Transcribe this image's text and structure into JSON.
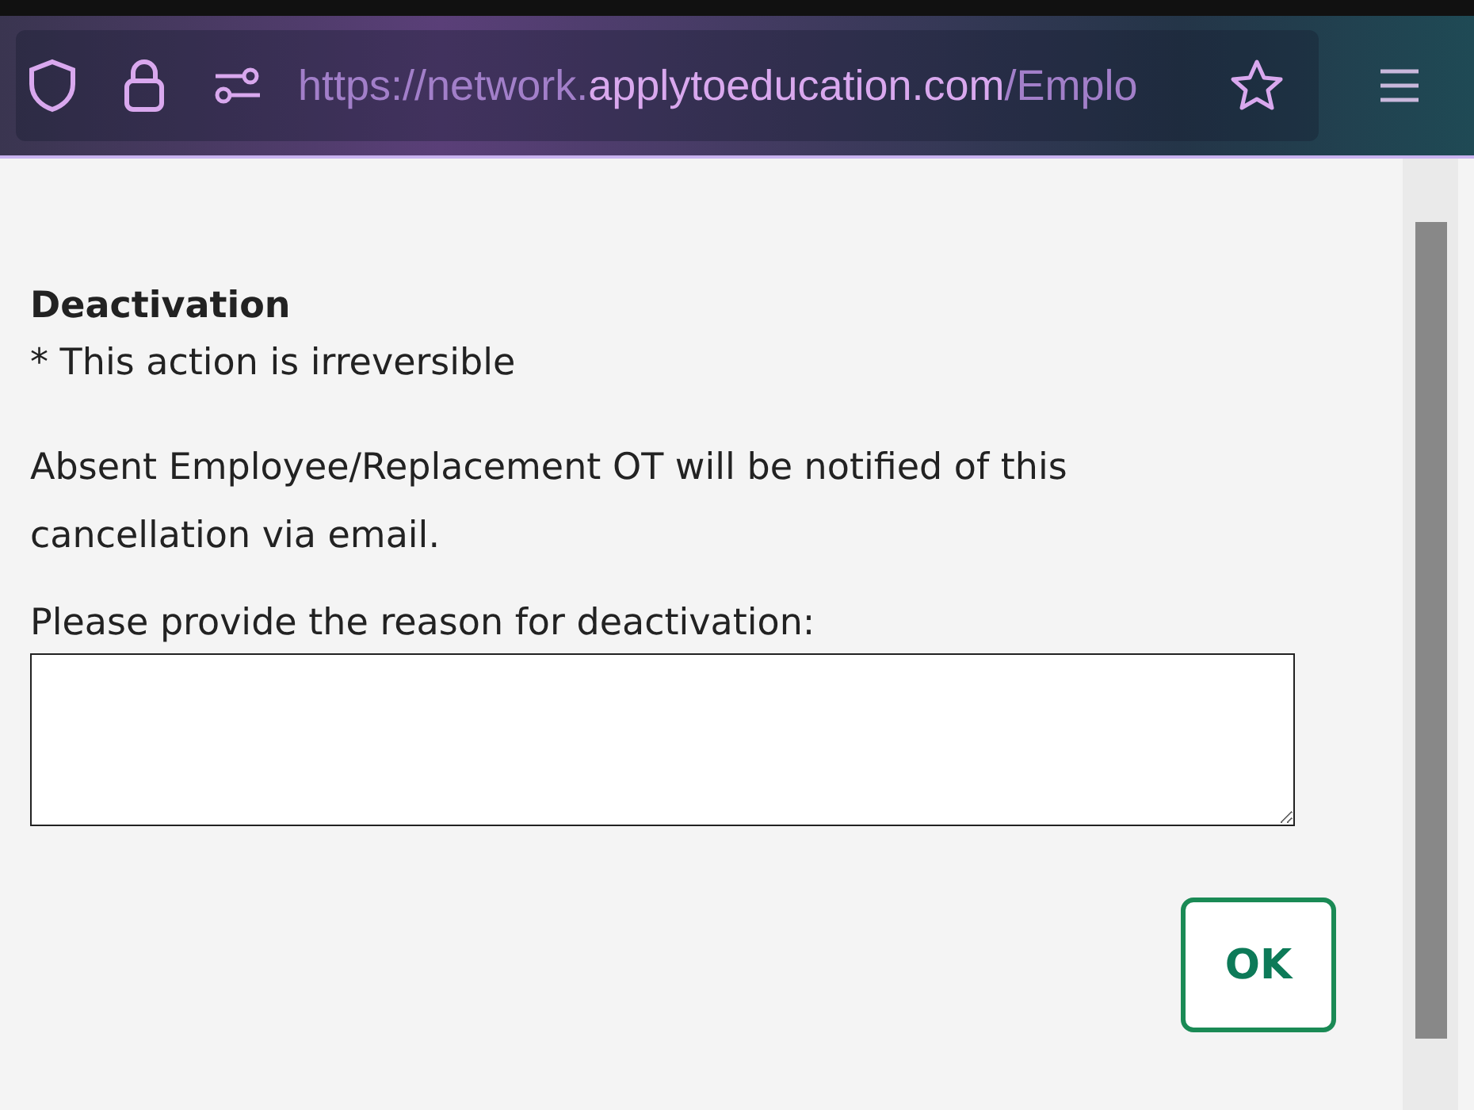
{
  "browser": {
    "url_scheme": "https://network.",
    "url_host": "applytoeducation.com",
    "url_path": "/Emplo"
  },
  "dialog": {
    "title": "Deactivation",
    "warning": "* This action is irreversible",
    "notice": "Absent Employee/Replacement OT will be notified of this cancellation via email.",
    "reason_label": "Please provide the reason for deactivation:",
    "ok_button": "OK"
  }
}
